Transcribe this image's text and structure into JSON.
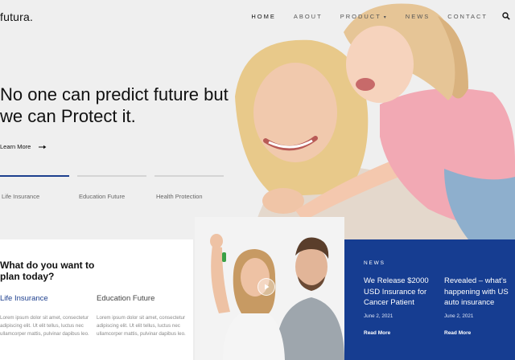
{
  "brand": {
    "logo": "futura.",
    "accent": "#1d3f8e",
    "news_bg": "#163d91"
  },
  "nav": {
    "items": [
      {
        "label": "HOME",
        "active": true
      },
      {
        "label": "ABOUT",
        "active": false
      },
      {
        "label": "PRODUCT",
        "active": false,
        "dropdown": true
      },
      {
        "label": "NEWS",
        "active": false
      },
      {
        "label": "CONTACT",
        "active": false
      }
    ],
    "search_icon": "search-icon"
  },
  "hero": {
    "headline": "No one can predict future but we can Protect it.",
    "cta_label": "Learn More",
    "tabs": [
      {
        "label": "Life Insurance",
        "active": true
      },
      {
        "label": "Education Future",
        "active": false
      },
      {
        "label": "Health Protection",
        "active": false
      }
    ]
  },
  "plan": {
    "title": "What do you want to plan today?",
    "columns": [
      {
        "title": "Life Insurance",
        "text": "Lorem ipsum dolor sit amet, consectetur adipiscing elit. Ut elit tellus, luctus nec ullamcorper mattis, pulvinar dapibus leo."
      },
      {
        "title": "Education Future",
        "text": "Lorem ipsum dolor sit amet, consectetur adipiscing elit. Ut elit tellus, luctus nec ullamcorper mattis, pulvinar dapibus leo."
      }
    ]
  },
  "video": {
    "play_icon": "play-icon"
  },
  "news": {
    "label": "NEWS",
    "items": [
      {
        "title": "We Release $2000 USD Insurance for Cancer Patient",
        "date": "June 2, 2021",
        "read_more": "Read More"
      },
      {
        "title": "Revealed – what’s happening with US auto insurance",
        "date": "June 2, 2021",
        "read_more": "Read More"
      }
    ]
  }
}
